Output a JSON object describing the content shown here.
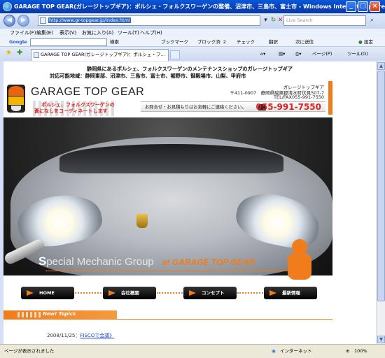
{
  "window": {
    "title": "GARAGE TOP GEAR(ガレージトップギア)：ポルシェ・フォルクスワーゲンの整備、沼津市、三島市、富士市 - Windows Internet Explorer",
    "btn_min": "_",
    "btn_max": "□",
    "btn_close": "×"
  },
  "address": {
    "url": "http://www.gr-topgear.jp/index.html",
    "search_placeholder": "Live Search"
  },
  "menu": [
    "ファイル(F)",
    "編集(E)",
    "表示(V)",
    "お気に入り(A)",
    "ツール(T)",
    "ヘルプ(H)"
  ],
  "google_toolbar": {
    "brand": "Google",
    "search_label": "検索",
    "bookmark_label": "ブックマーク",
    "block_label": "ブロック済: 2",
    "check_label": "チェック",
    "translate_label": "翻訳",
    "sendto_label": "次に送信",
    "settings_label": "設定"
  },
  "tabs": {
    "active_label": "GARAGE TOP GEAR(ガレージトップギア)：ポルシェ・フ...",
    "page_label": "ページ(P)",
    "tools_label": "ツール(O)"
  },
  "page": {
    "header_line1": "静岡県にあるポルシェ、フォルクスワーゲンのメンテナンスショップのガレージトップギア",
    "header_line2": "対応可能地域：静岡東部、沼津市、三島市、富士市、裾野市、御殿場市、山梨、甲府市",
    "brand_name": "GARAGE TOP GEAR",
    "tagline_1": "ポルシェ、フォルクスワーゲンの",
    "tagline_2": "蒼になしをコーディネートします",
    "shop_name": "ガレージトップギア",
    "shop_address": "〒411-0907　静岡県駿東郡清水町伏見507-7",
    "shop_telfax": "TEL/FAX055-991-7550",
    "contact_text": "お問合せ・お見積もりはお気軽にご連絡ください。",
    "phone": "055-991-7550",
    "hero_special": "S",
    "hero_special_rest": "pecial",
    "hero_group": " Mechanic Group",
    "hero_at": "at GARAGE TOP GEAR",
    "nav": [
      "HOME",
      "会社概要",
      "コンセプト",
      "最新情報"
    ],
    "topics_label": "New! Topics",
    "news_date": "2008/11/25",
    "news_sep": "：",
    "news_link": "FISCOで会議》"
  },
  "status": {
    "text": "ページが表示されました",
    "zone": "インターネット",
    "zoom": "100%"
  },
  "colors": {
    "accent": "#f07c1b",
    "phone_red": "#e02020",
    "titlebar": "#0a58d8"
  }
}
